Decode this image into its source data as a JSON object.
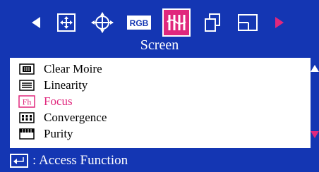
{
  "osd": {
    "section_title": "Screen",
    "tabs": [
      {
        "icon": "arrow-left-icon"
      },
      {
        "icon": "position-icon"
      },
      {
        "icon": "size-icon"
      },
      {
        "icon": "rgb-icon",
        "label": "RGB"
      },
      {
        "icon": "screen-icon",
        "selected": true
      },
      {
        "icon": "copy-icon"
      },
      {
        "icon": "window-icon"
      },
      {
        "icon": "arrow-right-icon"
      }
    ],
    "menu_items": [
      {
        "label": "Clear Moire",
        "icon": "clear-moire-icon"
      },
      {
        "label": "Linearity",
        "icon": "linearity-icon"
      },
      {
        "label": "Focus",
        "icon": "focus-icon",
        "badge": "Fh",
        "active": true
      },
      {
        "label": "Convergence",
        "icon": "convergence-icon"
      },
      {
        "label": "Purity",
        "icon": "purity-icon"
      }
    ],
    "footer": {
      "text": ": Access Function",
      "icon": "enter-icon"
    }
  },
  "colors": {
    "background": "#1436b3",
    "accent": "#e0287d",
    "panel": "#ffffff",
    "text": "#000000"
  }
}
